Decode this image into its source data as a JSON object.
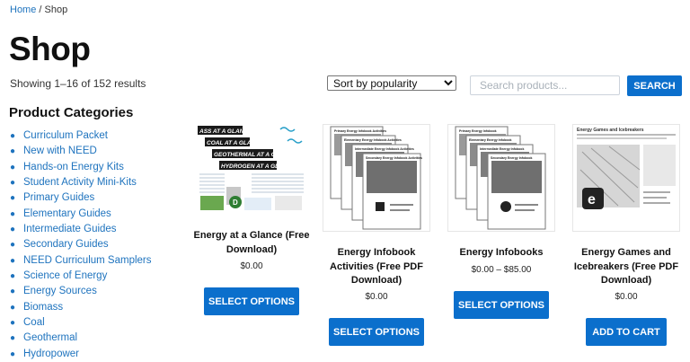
{
  "breadcrumb": {
    "home": "Home",
    "separator": " / ",
    "current": "Shop"
  },
  "page_title": "Shop",
  "result_count": "Showing 1–16 of 152 results",
  "sort": {
    "selected": "Sort by popularity"
  },
  "search": {
    "placeholder": "Search products...",
    "button": "SEARCH"
  },
  "categories": {
    "heading": "Product Categories",
    "items": [
      "Curriculum Packet",
      "New with NEED",
      "Hands-on Energy Kits",
      "Student Activity Mini-Kits",
      "Primary Guides",
      "Elementary Guides",
      "Intermediate Guides",
      "Secondary Guides",
      "NEED Curriculum Samplers",
      "Science of Energy",
      "Energy Sources",
      "Biomass",
      "Coal",
      "Geothermal",
      "Hydropower"
    ]
  },
  "products": [
    {
      "title": "Energy at a Glance (Free Download)",
      "price": "$0.00",
      "button": "SELECT OPTIONS"
    },
    {
      "title": "Energy Infobook Activities (Free PDF Download)",
      "price": "$0.00",
      "button": "SELECT OPTIONS"
    },
    {
      "title": "Energy Infobooks",
      "price": "$0.00 – $85.00",
      "button": "SELECT OPTIONS"
    },
    {
      "title": "Energy Games and Icebreakers (Free PDF Download)",
      "price": "$0.00",
      "button": "ADD TO CART"
    }
  ],
  "thumb_text": {
    "glance": [
      "ASS AT A GLANCE",
      "COAL AT A GLANCE",
      "GEOTHERMAL AT A GLANCE",
      "HYDROGEN AT A GLANCE"
    ],
    "activities": [
      "Primary Energy Infobook Activities",
      "Elementary Energy Infobook Activities",
      "Intermediate Energy Infobook Activities",
      "Secondary Energy Infobook Activities"
    ],
    "infobooks": [
      "Primary Energy Infobook",
      "Elementary Energy Infobook",
      "Intermediate Energy Infobook",
      "Secondary Energy Infobook"
    ],
    "games": "Energy Games and Icebreakers"
  },
  "colors": {
    "accent": "#0b6fcc",
    "link": "#1e73be"
  }
}
